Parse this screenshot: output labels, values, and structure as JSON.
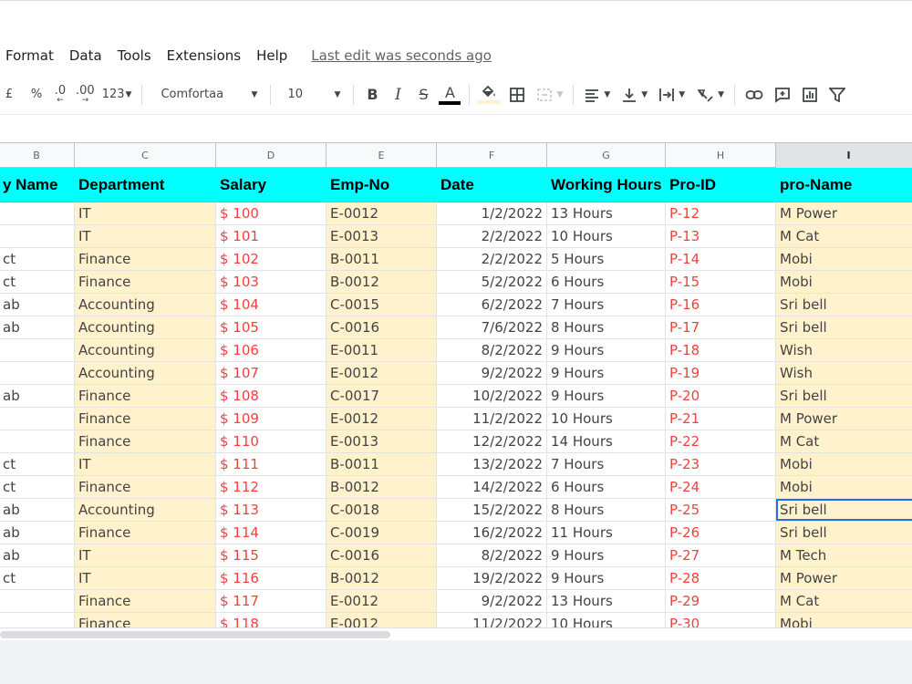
{
  "menu": {
    "items": [
      "Format",
      "Data",
      "Tools",
      "Extensions",
      "Help"
    ],
    "last_edit": "Last edit was seconds ago"
  },
  "toolbar": {
    "currency": "£",
    "percent": "%",
    "decrease_decimal": ".0",
    "increase_decimal": ".00",
    "number_format": "123",
    "font": "Comfortaa",
    "font_size": "10",
    "bold": "B",
    "italic": "I",
    "strike": "S",
    "text_color_letter": "A",
    "text_color": "#000000",
    "fill_color": "#fff2cc",
    "icons": [
      "borders-icon",
      "merge-cells-icon",
      "horizontal-align-icon",
      "vertical-align-icon",
      "text-wrap-icon",
      "text-rotation-icon",
      "insert-link-icon",
      "insert-comment-icon",
      "insert-chart-icon",
      "filter-icon"
    ]
  },
  "sheet": {
    "column_letters": [
      "B",
      "C",
      "D",
      "E",
      "F",
      "G",
      "H",
      "I"
    ],
    "selected_column": "I",
    "headers": [
      "y Name",
      "Department",
      "Salary",
      "Emp-No",
      "Date",
      "Working Hours",
      "Pro-ID",
      "pro-Name"
    ],
    "header_color": "#00ffff",
    "cream_color": "#fff2cc",
    "red_text_color": "#f0413f",
    "rows": [
      [
        "",
        "IT",
        "$ 100",
        "E-0012",
        "1/2/2022",
        "13 Hours",
        "P-12",
        "M Power"
      ],
      [
        "",
        "IT",
        "$ 101",
        "E-0013",
        "2/2/2022",
        "10 Hours",
        "P-13",
        "M Cat"
      ],
      [
        "ct",
        "Finance",
        "$ 102",
        "B-0011",
        "2/2/2022",
        "5 Hours",
        "P-14",
        "Mobi"
      ],
      [
        "ct",
        "Finance",
        "$ 103",
        "B-0012",
        "5/2/2022",
        "6 Hours",
        "P-15",
        "Mobi"
      ],
      [
        "ab",
        "Accounting",
        "$ 104",
        "C-0015",
        "6/2/2022",
        "7 Hours",
        "P-16",
        "Sri bell"
      ],
      [
        "ab",
        "Accounting",
        "$ 105",
        "C-0016",
        "7/6/2022",
        "8 Hours",
        "P-17",
        "Sri bell"
      ],
      [
        "",
        "Accounting",
        "$ 106",
        "E-0011",
        "8/2/2022",
        "9 Hours",
        "P-18",
        "Wish"
      ],
      [
        "",
        "Accounting",
        "$ 107",
        "E-0012",
        "9/2/2022",
        "9 Hours",
        "P-19",
        "Wish"
      ],
      [
        "ab",
        "Finance",
        "$ 108",
        "C-0017",
        "10/2/2022",
        "9 Hours",
        "P-20",
        "Sri bell"
      ],
      [
        "",
        "Finance",
        "$ 109",
        "E-0012",
        "11/2/2022",
        "10 Hours",
        "P-21",
        "M Power"
      ],
      [
        "",
        "Finance",
        "$ 110",
        "E-0013",
        "12/2/2022",
        "14 Hours",
        "P-22",
        "M Cat"
      ],
      [
        "ct",
        "IT",
        "$ 111",
        "B-0011",
        "13/2/2022",
        "7 Hours",
        "P-23",
        "Mobi"
      ],
      [
        "ct",
        "Finance",
        "$ 112",
        "B-0012",
        "14/2/2022",
        "6 Hours",
        "P-24",
        "Mobi"
      ],
      [
        "ab",
        "Accounting",
        "$ 113",
        "C-0018",
        "15/2/2022",
        "8 Hours",
        "P-25",
        "Sri bell"
      ],
      [
        "ab",
        "Finance",
        "$ 114",
        "C-0019",
        "16/2/2022",
        "11 Hours",
        "P-26",
        "Sri bell"
      ],
      [
        "ab",
        "IT",
        "$ 115",
        "C-0016",
        "8/2/2022",
        "9 Hours",
        "P-27",
        "M Tech"
      ],
      [
        "ct",
        "IT",
        "$ 116",
        "B-0012",
        "19/2/2022",
        "9 Hours",
        "P-28",
        "M Power"
      ],
      [
        "",
        "Finance",
        "$ 117",
        "E-0012",
        "9/2/2022",
        "13 Hours",
        "P-29",
        "M Cat"
      ],
      [
        "",
        "Finance",
        "$ 118",
        "E-0012",
        "11/2/2022",
        "10 Hours",
        "P-30",
        "Mobi"
      ]
    ],
    "selected_cell": {
      "row": 13,
      "col": 7
    }
  }
}
